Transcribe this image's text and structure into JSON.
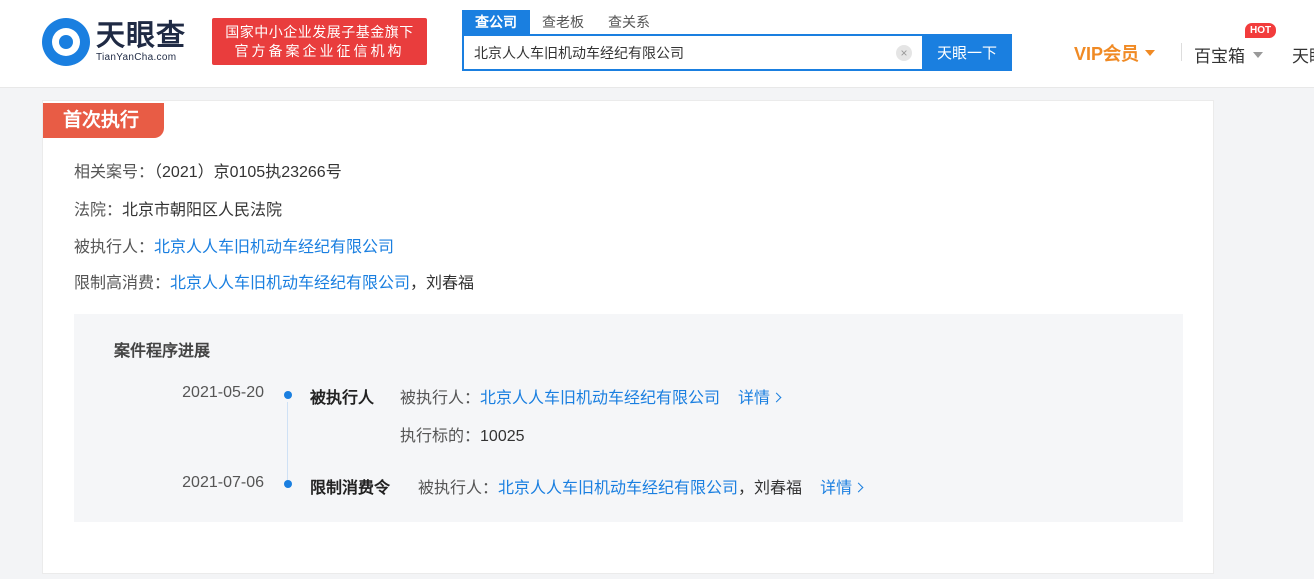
{
  "header": {
    "logo_name": "天眼查",
    "logo_sub": "TianYanCha.com",
    "badge_line1": "国家中小企业发展子基金旗下",
    "badge_line2": "官方备案企业征信机构",
    "search_tabs": [
      "查公司",
      "查老板",
      "查关系"
    ],
    "search_value": "北京人人车旧机动车经纪有限公司",
    "search_button": "天眼一下",
    "vip_label": "VIP会员",
    "toolbox_label": "百宝箱",
    "hot_badge": "HOT",
    "nav_more": "天眼"
  },
  "section": {
    "tag": "首次执行",
    "case_no_label": "相关案号：",
    "case_no_value": "（2021）京0105执23266号",
    "court_label": "法院：",
    "court_value": "北京市朝阳区人民法院",
    "executee_label": "被执行人：",
    "executee_value": "北京人人车旧机动车经纪有限公司",
    "restrict_label": "限制高消费：",
    "restrict_company": "北京人人车旧机动车经纪有限公司",
    "restrict_sep": "，",
    "restrict_person": "刘春福"
  },
  "progress": {
    "title": "案件程序进展",
    "events": [
      {
        "date": "2021-05-20",
        "type": "被执行人",
        "label": "被执行人：",
        "company": "北京人人车旧机动车经纪有限公司",
        "detail": "详情",
        "extra_label": "执行标的：",
        "extra_value": "10025"
      },
      {
        "date": "2021-07-06",
        "type": "限制消费令",
        "label": "被执行人：",
        "company": "北京人人车旧机动车经纪有限公司",
        "sep": "，",
        "person": "刘春福",
        "detail": "详情"
      }
    ]
  },
  "colors": {
    "brand_blue": "#1a7fe0",
    "tag_red": "#e85c45",
    "vip_orange": "#f08a24",
    "badge_red": "#e93d3d"
  }
}
